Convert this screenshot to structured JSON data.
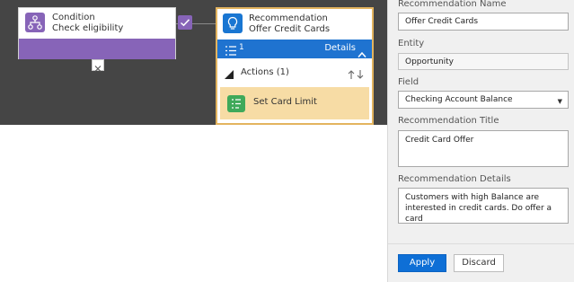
{
  "colors": {
    "canvas": "#454545",
    "condition_accent": "#8764b8",
    "recommendation_accent": "#1976d2",
    "details_bar": "#1f73d0",
    "selected_border": "#e3b45f",
    "action_item_bg": "#f7dca5",
    "action_icon": "#3fa95a",
    "apply_button": "#0e6fd6"
  },
  "canvas": {
    "condition_card": {
      "icon": "flow-branch-icon",
      "title": "Condition",
      "subtitle": "Check eligibility",
      "check_icon": "checkmark-icon",
      "close_icon": "close-icon"
    },
    "recommendation_card": {
      "icon": "lightbulb-icon",
      "title": "Recommendation",
      "subtitle": "Offer Credit Cards",
      "bar": {
        "list_icon": "list-icon",
        "count": "1",
        "details_label": "Details",
        "chevron_icon": "chevron-up-icon"
      },
      "actions": {
        "collapse_icon": "triangle-icon",
        "label": "Actions (1)",
        "sort_icon": "sort-arrows-icon"
      },
      "action_item": {
        "icon": "action-list-icon",
        "label": "Set Card Limit"
      }
    }
  },
  "panel": {
    "recommendation_name": {
      "label": "Recommendation Name",
      "value": "Offer Credit Cards"
    },
    "entity": {
      "label": "Entity",
      "value": "Opportunity"
    },
    "field": {
      "label": "Field",
      "value": "Checking Account Balance",
      "caret_icon": "dropdown-caret-icon"
    },
    "recommendation_title": {
      "label": "Recommendation Title",
      "value": "Credit Card Offer"
    },
    "recommendation_details": {
      "label": "Recommendation Details",
      "value": "Customers with high Balance are interested in credit cards. Do offer a card"
    },
    "apply_label": "Apply",
    "discard_label": "Discard"
  }
}
